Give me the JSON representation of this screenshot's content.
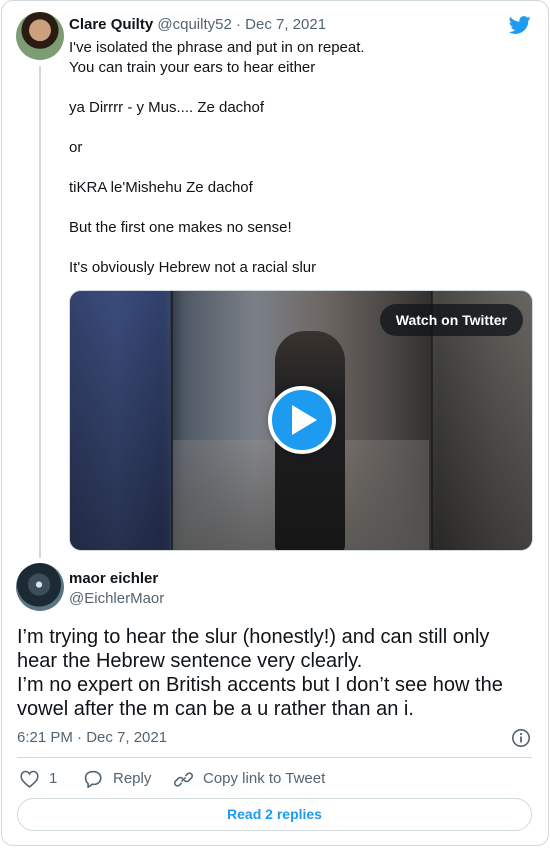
{
  "tweet1": {
    "name": "Clare Quilty",
    "handle": "@cquilty52",
    "separator": "·",
    "date": "Dec 7, 2021",
    "lines": [
      "I've isolated the phrase and put in on repeat.",
      "You can train your ears to hear either",
      "",
      "ya Dirrrr - y Mus.... Ze dachof",
      "",
      "or",
      "",
      "tiKRA le'Mishehu Ze dachof",
      "",
      "But the first one makes no sense!",
      "",
      "It's obviously Hebrew not a racial slur"
    ],
    "media": {
      "watch_label": "Watch on Twitter"
    }
  },
  "tweet2": {
    "name": "maor eichler",
    "handle": "@EichlerMaor",
    "text_lines": [
      "I’m trying to hear the slur (honestly!) and can still only hear the Hebrew sentence very clearly.",
      "I’m no expert on British accents but I don’t see how the vowel after the m can be a u rather than an i."
    ],
    "time": "6:21 PM · Dec 7, 2021",
    "like_count": "1",
    "reply_label": "Reply",
    "copy_label": "Copy link to Tweet",
    "read_replies_label": "Read 2 replies"
  },
  "colors": {
    "accent": "#1d9bf0",
    "text": "#0f1419",
    "muted": "#536471",
    "border": "#cfd9de"
  }
}
